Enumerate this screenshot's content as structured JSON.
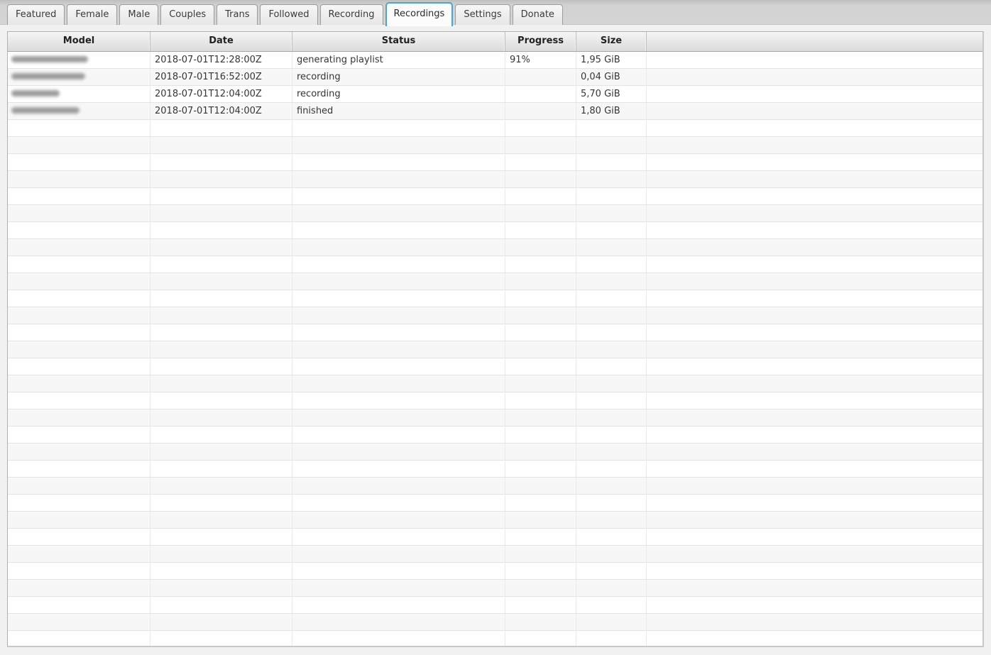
{
  "app": {
    "accent_color": "#47a6d8",
    "tab_band_color": "#d2d2d2",
    "pane_background": "#f1f1f1",
    "row_stripe_colors": [
      "#ffffff",
      "#f7f7f7"
    ]
  },
  "tabs": [
    {
      "label": "Featured",
      "selected": false
    },
    {
      "label": "Female",
      "selected": false
    },
    {
      "label": "Male",
      "selected": false
    },
    {
      "label": "Couples",
      "selected": false
    },
    {
      "label": "Trans",
      "selected": false
    },
    {
      "label": "Followed",
      "selected": false
    },
    {
      "label": "Recording",
      "selected": false
    },
    {
      "label": "Recordings",
      "selected": true
    },
    {
      "label": "Settings",
      "selected": false
    },
    {
      "label": "Donate",
      "selected": false
    }
  ],
  "table": {
    "columns": [
      {
        "label": "Model"
      },
      {
        "label": "Date"
      },
      {
        "label": "Status"
      },
      {
        "label": "Progress"
      },
      {
        "label": "Size"
      },
      {
        "label": ""
      }
    ],
    "rows": [
      {
        "model_censored": true,
        "model_blur_width": 108,
        "date": "2018-07-01T12:28:00Z",
        "status": "generating playlist",
        "progress": "91%",
        "size": "1,95 GiB"
      },
      {
        "model_censored": true,
        "model_blur_width": 104,
        "date": "2018-07-01T16:52:00Z",
        "status": "recording",
        "progress": "",
        "size": "0,04 GiB"
      },
      {
        "model_censored": true,
        "model_blur_width": 68,
        "date": "2018-07-01T12:04:00Z",
        "status": "recording",
        "progress": "",
        "size": "5,70 GiB"
      },
      {
        "model_censored": true,
        "model_blur_width": 96,
        "date": "2018-07-01T12:04:00Z",
        "status": "finished",
        "progress": "",
        "size": "1,80 GiB"
      }
    ],
    "empty_row_count": 31
  }
}
